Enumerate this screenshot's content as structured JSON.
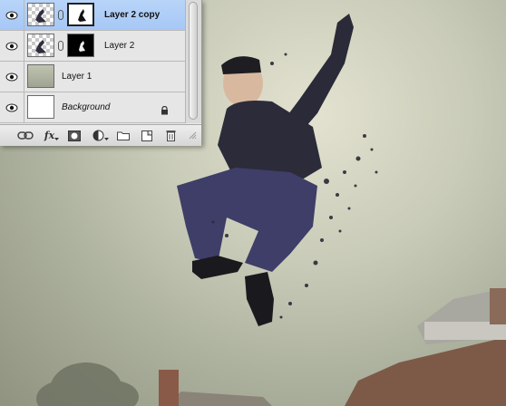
{
  "layers_panel": {
    "layers": [
      {
        "name": "Layer 2 copy",
        "selected": true,
        "visible": true
      },
      {
        "name": "Layer 2",
        "selected": false,
        "visible": true
      },
      {
        "name": "Layer 1",
        "selected": false,
        "visible": true
      },
      {
        "name": "Background",
        "selected": false,
        "visible": true,
        "locked": true
      }
    ],
    "toolbar": {
      "buttons": [
        {
          "icon": "link-layers-icon"
        },
        {
          "icon": "fx-icon",
          "label": "fx"
        },
        {
          "icon": "add-mask-icon"
        },
        {
          "icon": "adjustment-layer-icon"
        },
        {
          "icon": "new-group-icon"
        },
        {
          "icon": "new-layer-icon"
        },
        {
          "icon": "trash-icon"
        }
      ]
    }
  },
  "colors": {
    "selection": "#a9caf6",
    "panel_bg": "#e6e6e6"
  }
}
